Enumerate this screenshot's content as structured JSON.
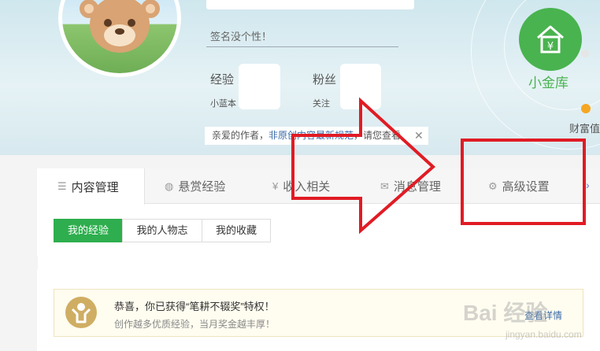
{
  "profile": {
    "signature": "签名没个性！",
    "stats": [
      {
        "label": "经验",
        "sub": "小蓝本"
      },
      {
        "label": "粉丝",
        "sub": "关注"
      }
    ]
  },
  "notice": {
    "text_prefix": "亲爱的作者，",
    "text_link": "非原创内容最新规范",
    "text_suffix": "，请您查看",
    "close": "✕"
  },
  "vault": {
    "label": "小金库",
    "symbol": "¥",
    "wealth": "财富值"
  },
  "tabs": [
    {
      "label": "内容管理",
      "icon": "list-icon",
      "glyph": "☰"
    },
    {
      "label": "悬赏经验",
      "icon": "reward-icon",
      "glyph": "◍"
    },
    {
      "label": "收入相关",
      "icon": "yen-icon",
      "glyph": "¥"
    },
    {
      "label": "消息管理",
      "icon": "mail-icon",
      "glyph": "✉"
    },
    {
      "label": "高级设置",
      "icon": "gear-icon",
      "glyph": "⚙"
    }
  ],
  "tab_scroll": "›",
  "subtabs": [
    "我的经验",
    "我的人物志",
    "我的收藏"
  ],
  "reward": {
    "title": "恭喜，你已获得“笔耕不辍奖”特权！",
    "desc": "创作越多优质经验，当月奖金越丰厚！",
    "link": "查看详情"
  },
  "watermark": {
    "text": "Bai 经验",
    "url": "jingyan.baidu.com"
  },
  "colors": {
    "accent_green": "#2eae4e",
    "annotation_red": "#e11b24"
  }
}
